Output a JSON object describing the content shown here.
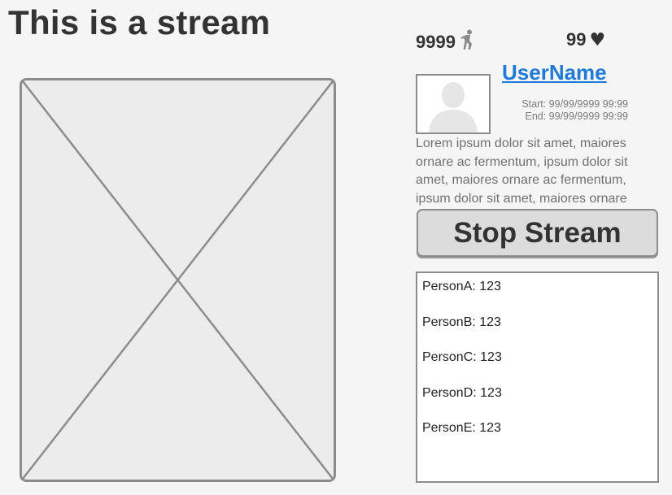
{
  "page": {
    "title": "This is a stream"
  },
  "stats": {
    "viewers": "9999",
    "viewers_icon": "person-walking-icon",
    "likes": "99",
    "likes_icon": "heart-icon",
    "heart_glyph": "♥"
  },
  "user": {
    "name": "UserName",
    "start": "Start: 99/99/9999 99:99",
    "end": "End: 99/99/9999 99:99",
    "avatar_icon": "user-avatar-placeholder"
  },
  "description": "Lorem ipsum dolor sit amet, maiores ornare ac fermentum, ipsum dolor sit amet, maiores ornare ac fermentum, ipsum dolor sit amet, maiores ornare",
  "controls": {
    "stop_label": "Stop Stream"
  },
  "chat": {
    "messages": [
      "PersonA: 123",
      "PersonB: 123",
      "PersonC: 123",
      "PersonD: 123",
      "PersonE: 123"
    ]
  },
  "colors": {
    "background": "#f5f5f5",
    "link": "#1e7ad6",
    "border": "#8c8c8c",
    "button": "#dcdcdc"
  }
}
